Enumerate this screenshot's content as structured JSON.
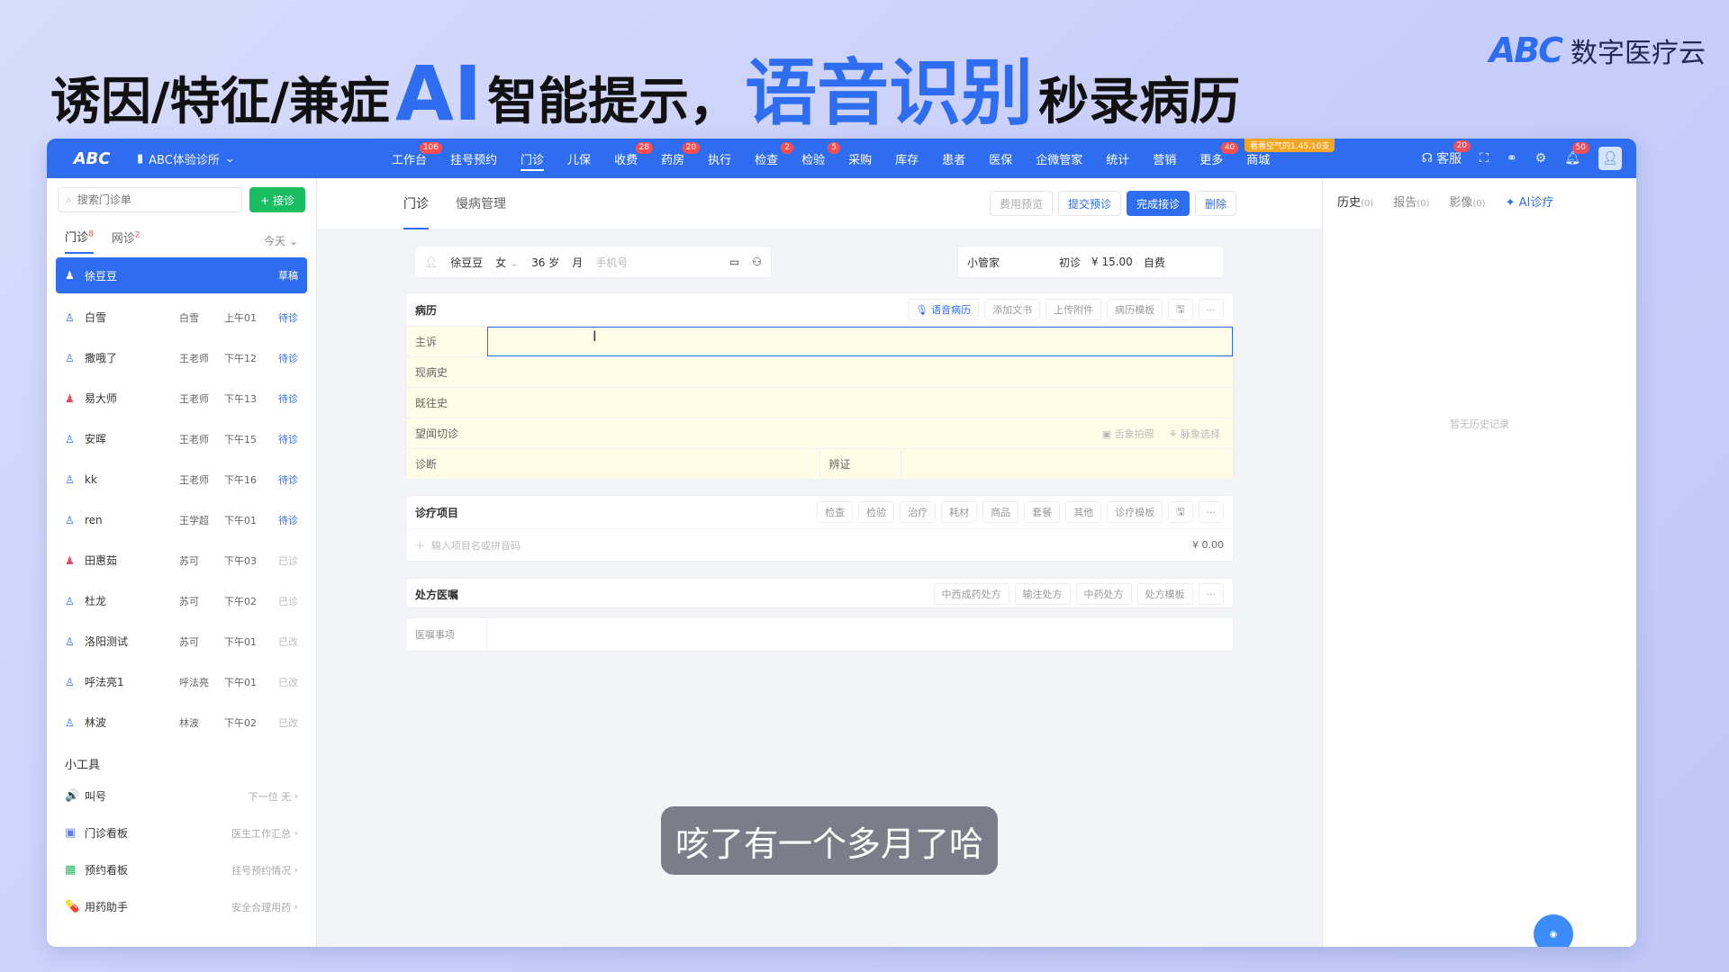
{
  "headline": {
    "part1": "诱因/特征/兼症",
    "ai": "AI",
    "part2": "智能提示，",
    "voice": "语音识别",
    "part3": "秒录病历"
  },
  "brand": {
    "logo": "ABC",
    "name": "数字医疗云"
  },
  "topbar": {
    "logo": "ABC",
    "clinic": "ABC体验诊所",
    "promo": "看看空气的1.45.10支",
    "nav": [
      {
        "label": "工作台",
        "badge": "106"
      },
      {
        "label": "挂号预约",
        "badge": ""
      },
      {
        "label": "门诊",
        "badge": ""
      },
      {
        "label": "儿保",
        "badge": ""
      },
      {
        "label": "收费",
        "badge": "28"
      },
      {
        "label": "药房",
        "badge": "20"
      },
      {
        "label": "执行",
        "badge": ""
      },
      {
        "label": "检查",
        "badge": "2"
      },
      {
        "label": "检验",
        "badge": "5"
      },
      {
        "label": "采购",
        "badge": ""
      },
      {
        "label": "库存",
        "badge": ""
      },
      {
        "label": "患者",
        "badge": ""
      },
      {
        "label": "医保",
        "badge": ""
      },
      {
        "label": "企微管家",
        "badge": ""
      },
      {
        "label": "统计",
        "badge": ""
      },
      {
        "label": "营销",
        "badge": ""
      },
      {
        "label": "更多",
        "badge": "40"
      },
      {
        "label": "商城",
        "badge": ""
      }
    ],
    "service_label": "客服",
    "service_badge": "20",
    "bell_badge": "50"
  },
  "left": {
    "search_placeholder": "搜索门诊单",
    "add_button": "+ 接诊",
    "tab_outpatient": "门诊",
    "tab_outpatient_count": "8",
    "tab_online": "网诊",
    "tab_online_count": "2",
    "date_filter": "今天",
    "patients": [
      {
        "name": "徐豆豆",
        "doctor": "",
        "time": "",
        "status": "草稿",
        "gender": "female",
        "done": false
      },
      {
        "name": "白雪",
        "doctor": "白雪",
        "time": "上午01",
        "status": "待诊",
        "gender": "male",
        "done": false
      },
      {
        "name": "撒哦了",
        "doctor": "王老师",
        "time": "下午12",
        "status": "待诊",
        "gender": "male",
        "done": false
      },
      {
        "name": "易大师",
        "doctor": "王老师",
        "time": "下午13",
        "status": "待诊",
        "gender": "female",
        "done": false
      },
      {
        "name": "安晖",
        "doctor": "王老师",
        "time": "下午15",
        "status": "待诊",
        "gender": "male",
        "done": false
      },
      {
        "name": "kk",
        "doctor": "王老师",
        "time": "下午16",
        "status": "待诊",
        "gender": "male",
        "done": false
      },
      {
        "name": "ren",
        "doctor": "王学超",
        "time": "下午01",
        "status": "待诊",
        "gender": "male",
        "done": false
      },
      {
        "name": "田惠茹",
        "doctor": "苏可",
        "time": "下午03",
        "status": "已诊",
        "gender": "female",
        "done": true
      },
      {
        "name": "杜龙",
        "doctor": "苏可",
        "time": "下午02",
        "status": "已诊",
        "gender": "male",
        "done": true
      },
      {
        "name": "洛阳测试",
        "doctor": "苏可",
        "time": "下午01",
        "status": "已改",
        "gender": "male",
        "done": true
      },
      {
        "name": "呼法亮1",
        "doctor": "呼法亮",
        "time": "下午01",
        "status": "已改",
        "gender": "male",
        "done": true
      },
      {
        "name": "林波",
        "doctor": "林波",
        "time": "下午02",
        "status": "已改",
        "gender": "male",
        "done": true
      }
    ],
    "tools_title": "小工具",
    "tools": [
      {
        "name": "叫号",
        "desc": "下一位 无",
        "icon": "🔊",
        "color": "#2f6df0"
      },
      {
        "name": "门诊看板",
        "desc": "医生工作汇总",
        "icon": "▣",
        "color": "#5b7cf7"
      },
      {
        "name": "预约看板",
        "desc": "挂号预约情况",
        "icon": "▦",
        "color": "#1bbd63"
      },
      {
        "name": "用药助手",
        "desc": "安全合理用药",
        "icon": "💊",
        "color": "#f5a623"
      }
    ]
  },
  "center": {
    "tab_outpatient": "门诊",
    "tab_chronic": "慢病管理",
    "btn_fee_preview": "费用预览",
    "btn_submit_pre": "提交预诊",
    "btn_complete": "完成接诊",
    "btn_delete": "删除",
    "patient": {
      "name": "徐豆豆",
      "gender": "女",
      "age": "36 岁",
      "month_label": "月",
      "phone_placeholder": "手机号",
      "steward": "小管家",
      "visit_type": "初诊",
      "fee": "¥ 15.00",
      "pay_type": "自费"
    },
    "record": {
      "title": "病历",
      "btn_voice": "语音病历",
      "btn_add_doc": "添加文书",
      "btn_upload": "上传附件",
      "btn_template": "病历模板",
      "rows": [
        {
          "label": "主诉"
        },
        {
          "label": "现病史"
        },
        {
          "label": "既往史"
        },
        {
          "label": "望闻切诊"
        }
      ],
      "tongue_photo": "舌象拍照",
      "pulse_select": "脉象选择",
      "diag_label": "诊断",
      "syndrome_label": "辨证"
    },
    "items": {
      "title": "诊疗项目",
      "buttons": [
        "检查",
        "检验",
        "治疗",
        "耗材",
        "商品",
        "套餐",
        "其他"
      ],
      "template": "诊疗模板",
      "input_placeholder": "输入项目名或拼音码",
      "amount": "¥ 0.00"
    },
    "rx": {
      "title": "处方医嘱",
      "buttons": [
        "中西成药处方",
        "输注处方",
        "中药处方"
      ],
      "template": "处方模板"
    },
    "advice_label": "医嘱事项"
  },
  "right": {
    "tab_history": "历史",
    "tab_history_count": "(0)",
    "tab_report": "报告",
    "tab_report_count": "(0)",
    "tab_image": "影像",
    "tab_image_count": "(0)",
    "tab_ai": "AI诊疗",
    "empty": "暂无历史记录"
  },
  "subtitle": "咳了有一个多月了哈",
  "colors": {
    "primary": "#2f6df0",
    "green": "#1bbd63",
    "badge_red": "#ff4d4f"
  }
}
